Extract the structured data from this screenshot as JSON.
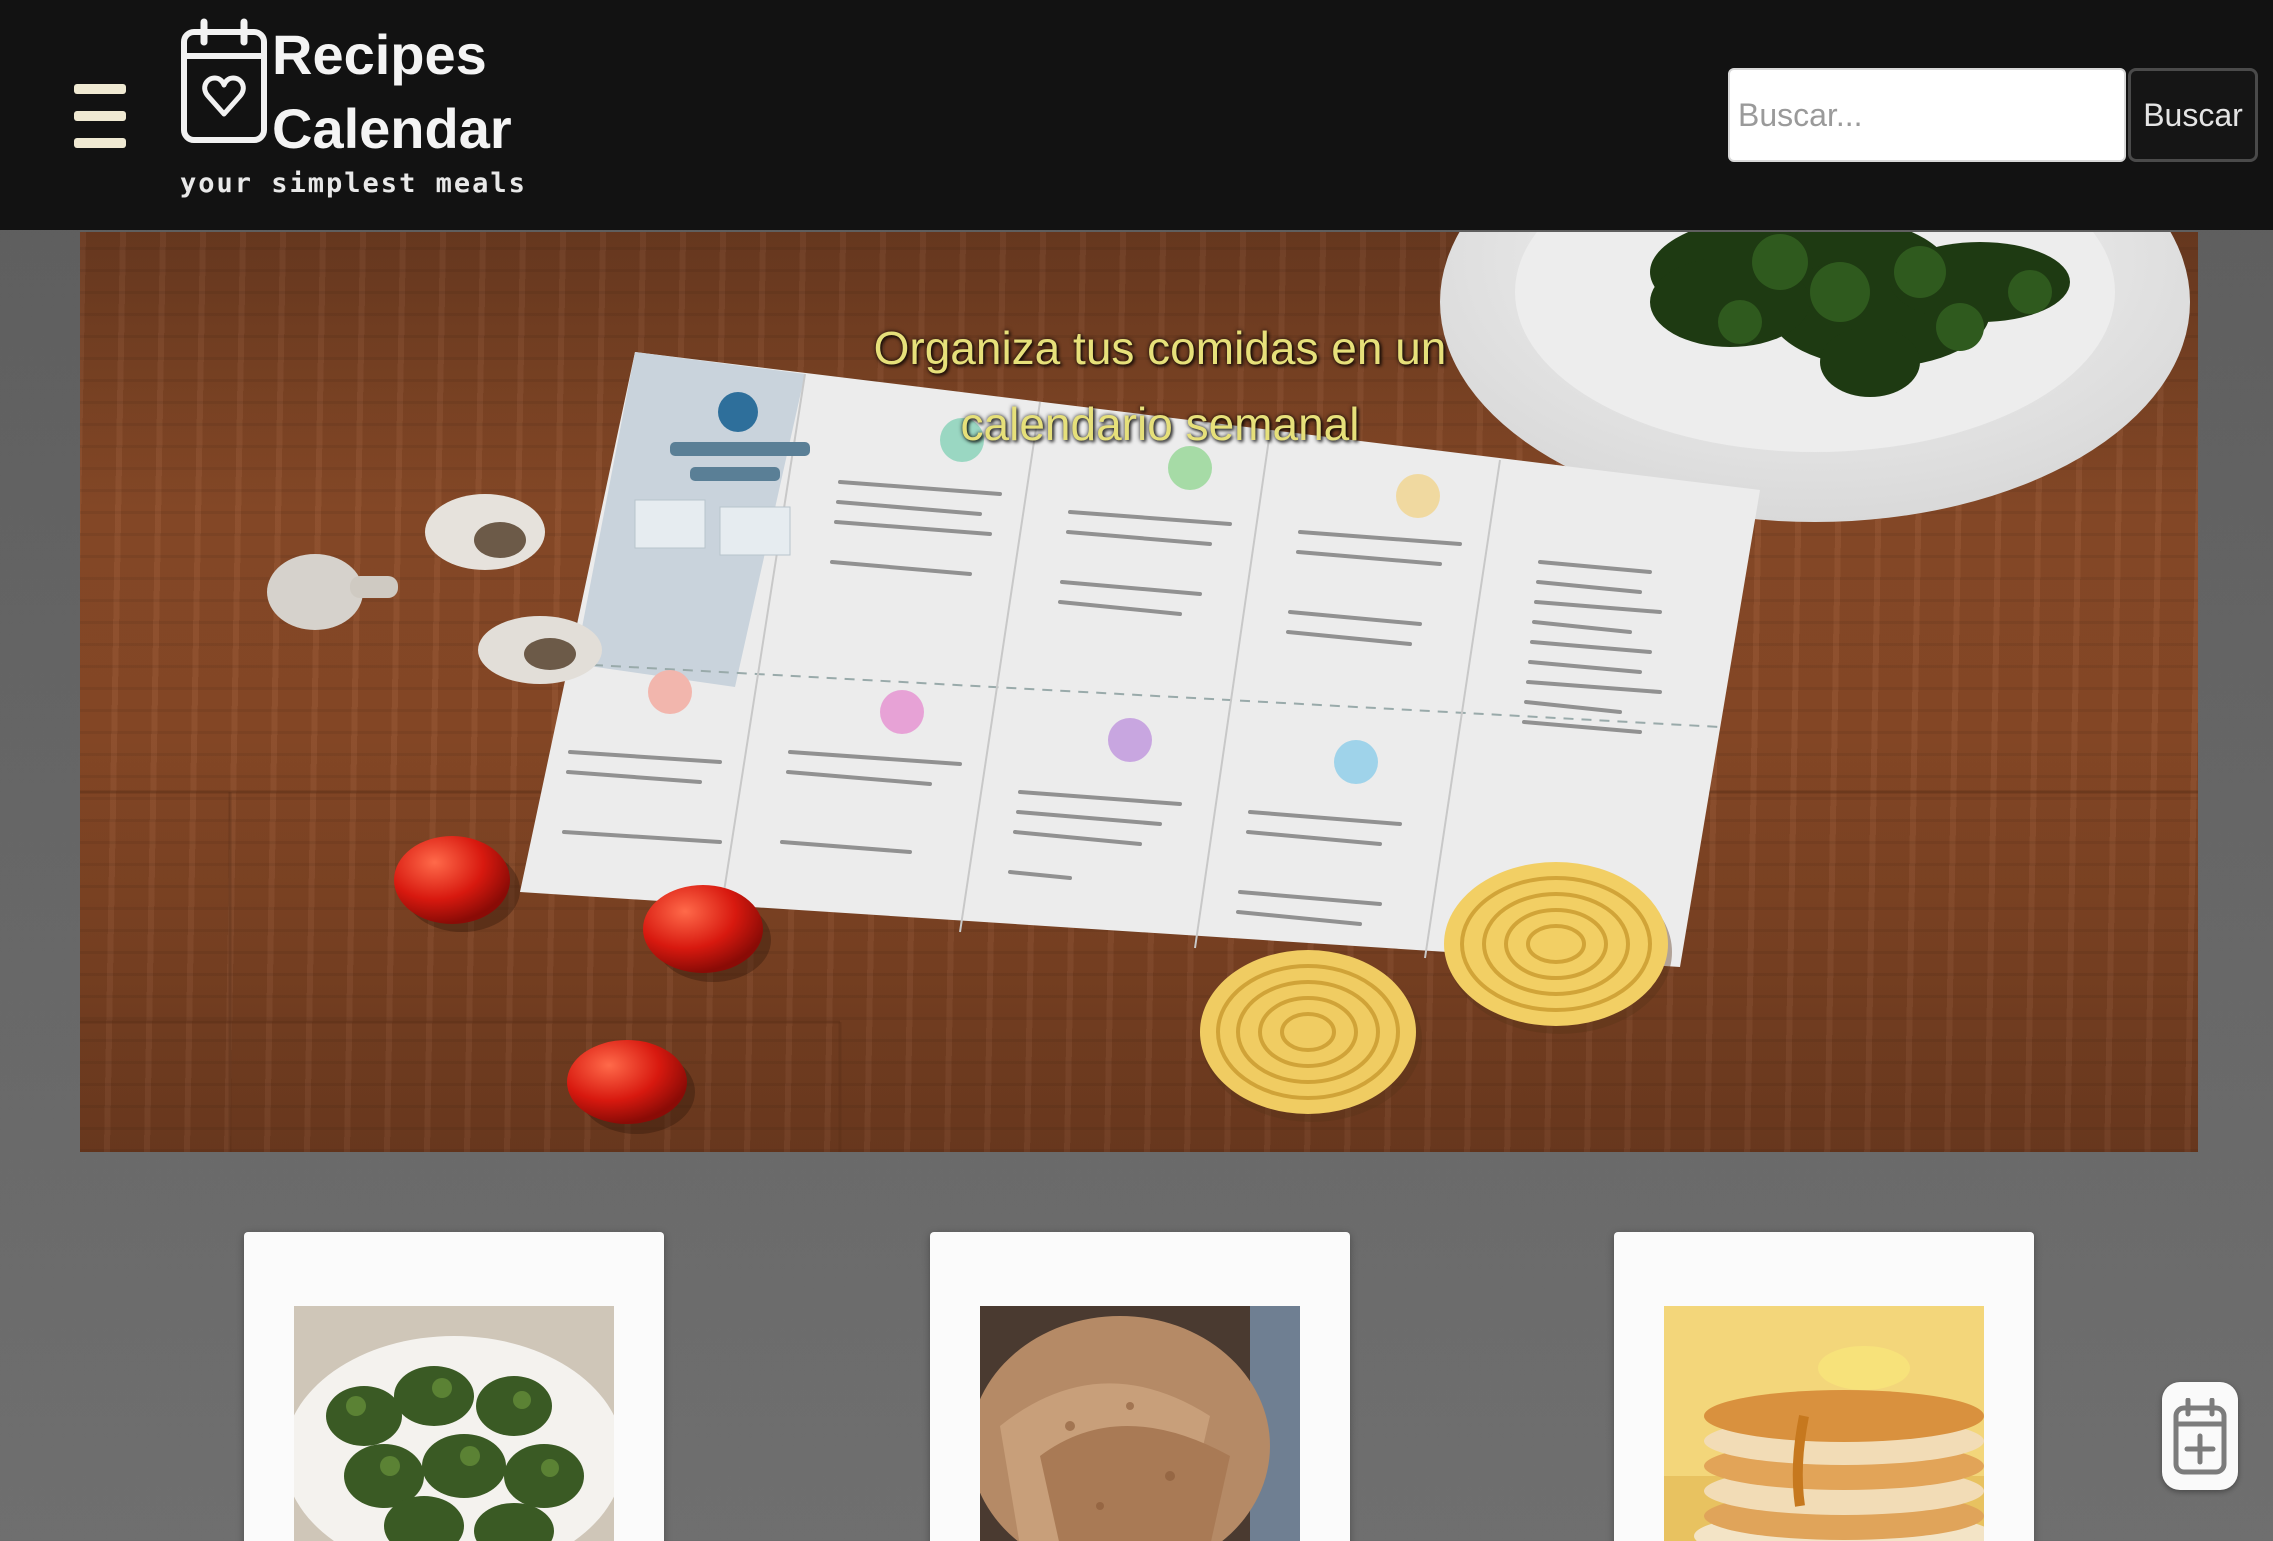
{
  "header": {
    "menu_icon": "hamburger-menu-icon",
    "logo": {
      "icon": "calendar-heart-icon",
      "title_line1": "Recipes",
      "title_line2": "Calendar",
      "tagline": "your simplest meals"
    },
    "search": {
      "placeholder": "Buscar...",
      "value": "",
      "button_label": "Buscar"
    }
  },
  "hero": {
    "headline_line1": "Organiza tus comidas en un",
    "headline_line2": "calendario semanal"
  },
  "recipes": [
    {
      "image": "spinach-fritters"
    },
    {
      "image": "flatbread-wraps"
    },
    {
      "image": "pancakes-with-syrup"
    }
  ],
  "fab": {
    "icon": "calendar-add-icon"
  },
  "colors": {
    "header_bg": "#121212",
    "hero_text": "#e6e07a",
    "page_bg": "#666666",
    "card_bg": "#fbfbfb"
  }
}
